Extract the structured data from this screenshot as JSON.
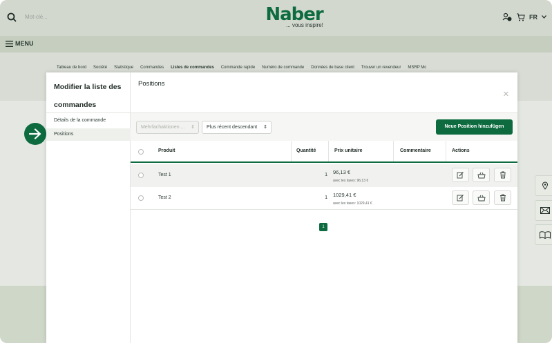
{
  "header": {
    "search_placeholder": "Mot-clé...",
    "logo_text": "Naber",
    "tagline": "... vous inspire!",
    "language": "FR"
  },
  "menu": {
    "label": "MENU"
  },
  "background_nav": [
    {
      "label": "Tableau de bord",
      "active": false
    },
    {
      "label": "Société",
      "active": false
    },
    {
      "label": "Statistique",
      "active": false
    },
    {
      "label": "Commandes",
      "active": false
    },
    {
      "label": "Listes de commandes",
      "active": true
    },
    {
      "label": "Commande rapide",
      "active": false
    },
    {
      "label": "Numéro de commande",
      "active": false
    },
    {
      "label": "Données de base client",
      "active": false
    },
    {
      "label": "Trouver un revendeur",
      "active": false
    },
    {
      "label": "MSRP Mc",
      "active": false
    }
  ],
  "modal": {
    "sidebar_title": "Modifier la liste des commandes",
    "sidebar_items": [
      "Détails de la commande",
      "Positions"
    ],
    "title": "Positions",
    "close_icon": "close-icon",
    "bulk_actions": "Mehrfachaktionen ...",
    "sort": "Plus récent descendant",
    "add_button": "Neue Position hinzufügen",
    "columns": [
      "Produit",
      "Quantité",
      "Prix unitaire",
      "Commentaire",
      "Actions"
    ],
    "rows": [
      {
        "product": "Test 1",
        "quantity": "1",
        "price": "96,13 €",
        "tax": "avec les taxes: 96,13 €"
      },
      {
        "product": "Test 2",
        "quantity": "1",
        "price": "1029,41 €",
        "tax": "avec les taxes: 1029,41 €"
      }
    ],
    "page": "1"
  },
  "colors": {
    "brand": "#0d6b3f"
  }
}
